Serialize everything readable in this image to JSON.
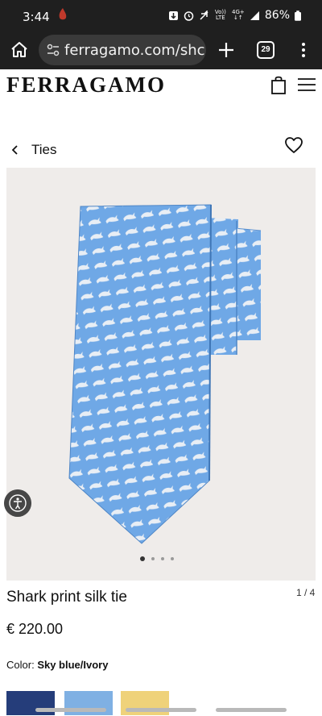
{
  "status_bar": {
    "time": "3:44",
    "battery": "86%",
    "network_top": "Vo))",
    "network_bottom": "LTE",
    "signal_top": "4G+",
    "signal_bottom": "↓↑"
  },
  "browser": {
    "url": "ferragamo.com/shc",
    "tab_count": "29"
  },
  "site": {
    "logo": "FERRAGAMO"
  },
  "breadcrumb": {
    "label": "Ties"
  },
  "gallery": {
    "pager": "1 / 4",
    "dots": 4,
    "active_dot": 0,
    "tie_color": "#6fa8e6"
  },
  "product": {
    "title": "Shark print silk tie",
    "price": "€ 220.00",
    "color_label": "Color:",
    "color_value": "Sky blue/Ivory"
  }
}
